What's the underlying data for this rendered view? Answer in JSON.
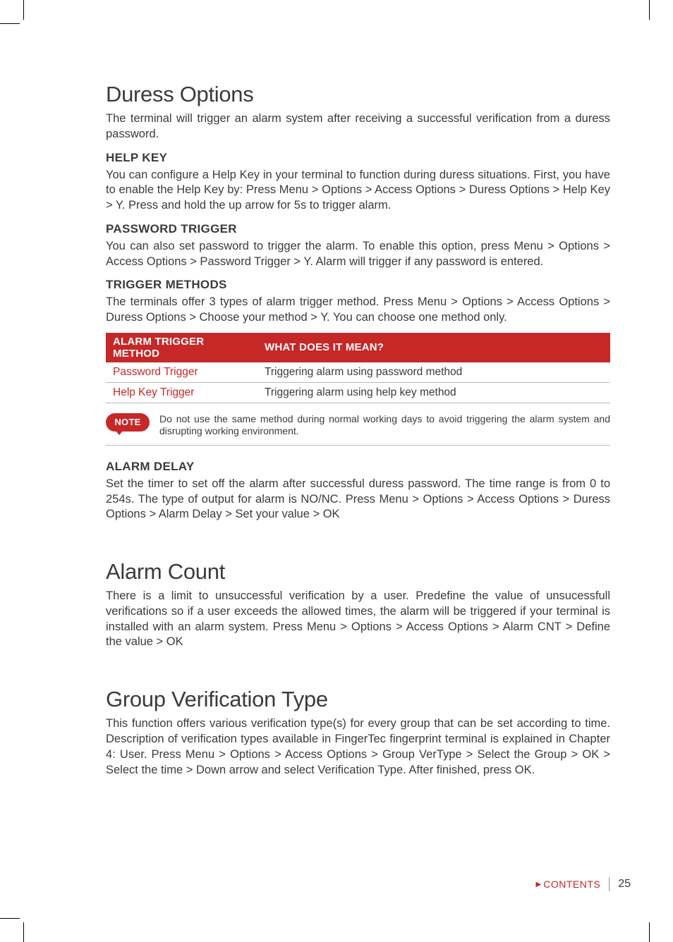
{
  "sections": {
    "duress": {
      "title": "Duress Options",
      "intro": "The terminal will trigger an alarm system after receiving a successful verification from a duress password.",
      "help_key": {
        "heading": "HELP KEY",
        "body": "You can configure a Help Key in your terminal to function during duress situations. First, you have to enable the Help Key by: Press Menu > Options > Access Options > Duress Options > Help Key > Y. Press and hold the up arrow for 5s to trigger alarm."
      },
      "password_trigger": {
        "heading": "PASSWORD TRIGGER",
        "body": "You can also set password to trigger the alarm. To enable this option, press Menu > Options > Access Options > Password Trigger > Y. Alarm will trigger if any password is entered."
      },
      "trigger_methods": {
        "heading": "TRIGGER METHODS",
        "body": "The terminals offer 3 types of alarm trigger method. Press Menu > Options > Access Options > Duress Options > Choose your method > Y. You can choose one method only.",
        "table": {
          "headers": [
            "ALARM TRIGGER METHOD",
            "WHAT DOES IT MEAN?"
          ],
          "rows": [
            [
              "Password Trigger",
              "Triggering alarm using password method"
            ],
            [
              "Help Key Trigger",
              "Triggering alarm using help key method"
            ]
          ]
        },
        "note_label": "NOTE",
        "note_text": "Do not use the same method during normal working days to avoid triggering the alarm system and disrupting working environment."
      },
      "alarm_delay": {
        "heading": "ALARM DELAY",
        "body": "Set the timer to set off the alarm after successful duress password. The time range is from 0 to 254s. The type of output for alarm is NO/NC. Press Menu > Options > Access Options > Duress Options > Alarm Delay > Set your value > OK"
      }
    },
    "alarm_count": {
      "title": "Alarm Count",
      "body": "There is a limit to unsuccessful verification by a user. Predefine the value of unsucessfull verifications so if a user exceeds the allowed times, the alarm will be triggered if your terminal is installed with an alarm system. Press Menu > Options > Access Options > Alarm CNT > Define the value > OK"
    },
    "group_verification": {
      "title": "Group Verification Type",
      "body": "This function offers various verification type(s) for every group that can be set according to time. Description of verification types available in FingerTec fingerprint terminal is explained in Chapter 4: User. Press Menu > Options > Access Options > Group VerType > Select the Group > OK > Select the time > Down arrow and select Verification Type. After finished, press OK."
    }
  },
  "footer": {
    "contents_label": "CONTENTS",
    "page_number": "25"
  }
}
